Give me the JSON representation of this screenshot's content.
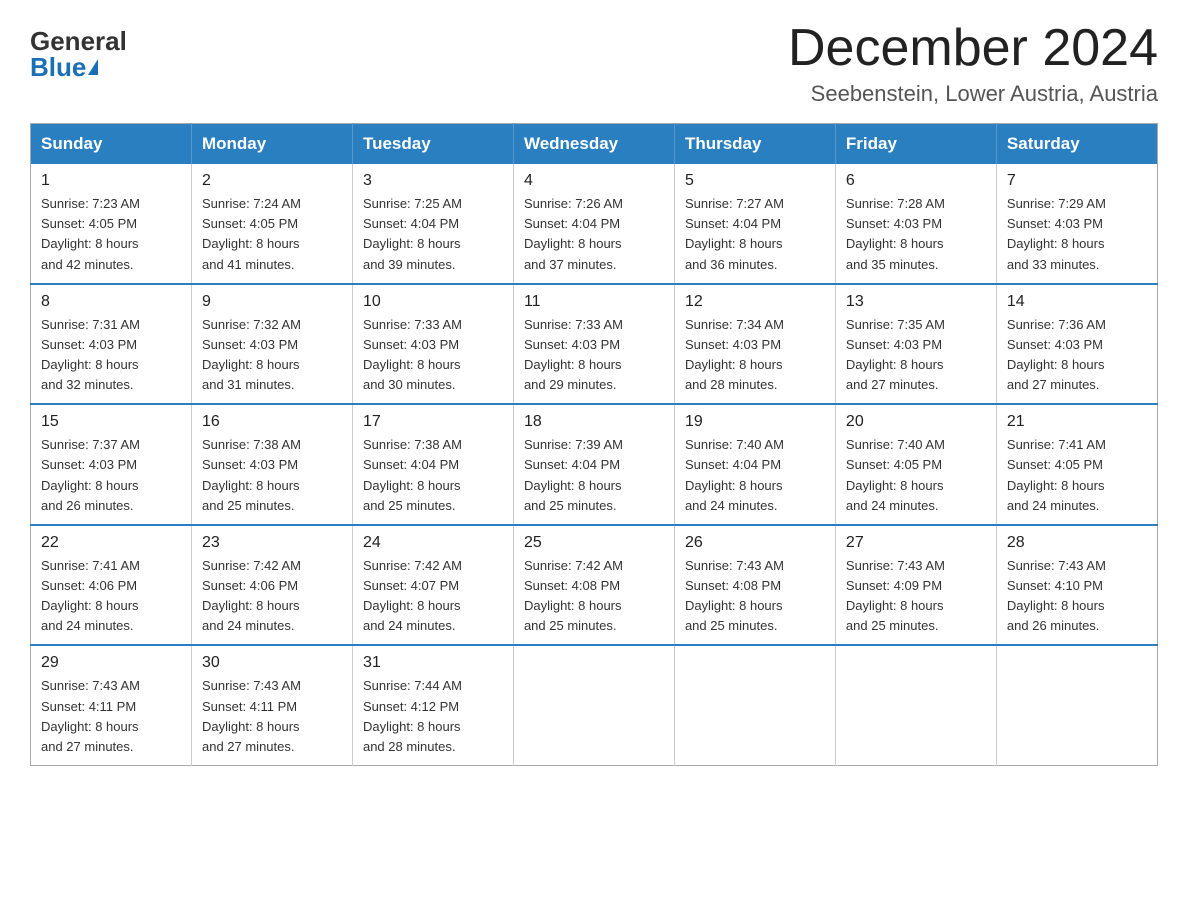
{
  "logo": {
    "general": "General",
    "blue": "Blue"
  },
  "title": "December 2024",
  "subtitle": "Seebenstein, Lower Austria, Austria",
  "weekdays": [
    "Sunday",
    "Monday",
    "Tuesday",
    "Wednesday",
    "Thursday",
    "Friday",
    "Saturday"
  ],
  "weeks": [
    [
      {
        "day": "1",
        "sunrise": "7:23 AM",
        "sunset": "4:05 PM",
        "daylight": "8 hours and 42 minutes."
      },
      {
        "day": "2",
        "sunrise": "7:24 AM",
        "sunset": "4:05 PM",
        "daylight": "8 hours and 41 minutes."
      },
      {
        "day": "3",
        "sunrise": "7:25 AM",
        "sunset": "4:04 PM",
        "daylight": "8 hours and 39 minutes."
      },
      {
        "day": "4",
        "sunrise": "7:26 AM",
        "sunset": "4:04 PM",
        "daylight": "8 hours and 37 minutes."
      },
      {
        "day": "5",
        "sunrise": "7:27 AM",
        "sunset": "4:04 PM",
        "daylight": "8 hours and 36 minutes."
      },
      {
        "day": "6",
        "sunrise": "7:28 AM",
        "sunset": "4:03 PM",
        "daylight": "8 hours and 35 minutes."
      },
      {
        "day": "7",
        "sunrise": "7:29 AM",
        "sunset": "4:03 PM",
        "daylight": "8 hours and 33 minutes."
      }
    ],
    [
      {
        "day": "8",
        "sunrise": "7:31 AM",
        "sunset": "4:03 PM",
        "daylight": "8 hours and 32 minutes."
      },
      {
        "day": "9",
        "sunrise": "7:32 AM",
        "sunset": "4:03 PM",
        "daylight": "8 hours and 31 minutes."
      },
      {
        "day": "10",
        "sunrise": "7:33 AM",
        "sunset": "4:03 PM",
        "daylight": "8 hours and 30 minutes."
      },
      {
        "day": "11",
        "sunrise": "7:33 AM",
        "sunset": "4:03 PM",
        "daylight": "8 hours and 29 minutes."
      },
      {
        "day": "12",
        "sunrise": "7:34 AM",
        "sunset": "4:03 PM",
        "daylight": "8 hours and 28 minutes."
      },
      {
        "day": "13",
        "sunrise": "7:35 AM",
        "sunset": "4:03 PM",
        "daylight": "8 hours and 27 minutes."
      },
      {
        "day": "14",
        "sunrise": "7:36 AM",
        "sunset": "4:03 PM",
        "daylight": "8 hours and 27 minutes."
      }
    ],
    [
      {
        "day": "15",
        "sunrise": "7:37 AM",
        "sunset": "4:03 PM",
        "daylight": "8 hours and 26 minutes."
      },
      {
        "day": "16",
        "sunrise": "7:38 AM",
        "sunset": "4:03 PM",
        "daylight": "8 hours and 25 minutes."
      },
      {
        "day": "17",
        "sunrise": "7:38 AM",
        "sunset": "4:04 PM",
        "daylight": "8 hours and 25 minutes."
      },
      {
        "day": "18",
        "sunrise": "7:39 AM",
        "sunset": "4:04 PM",
        "daylight": "8 hours and 25 minutes."
      },
      {
        "day": "19",
        "sunrise": "7:40 AM",
        "sunset": "4:04 PM",
        "daylight": "8 hours and 24 minutes."
      },
      {
        "day": "20",
        "sunrise": "7:40 AM",
        "sunset": "4:05 PM",
        "daylight": "8 hours and 24 minutes."
      },
      {
        "day": "21",
        "sunrise": "7:41 AM",
        "sunset": "4:05 PM",
        "daylight": "8 hours and 24 minutes."
      }
    ],
    [
      {
        "day": "22",
        "sunrise": "7:41 AM",
        "sunset": "4:06 PM",
        "daylight": "8 hours and 24 minutes."
      },
      {
        "day": "23",
        "sunrise": "7:42 AM",
        "sunset": "4:06 PM",
        "daylight": "8 hours and 24 minutes."
      },
      {
        "day": "24",
        "sunrise": "7:42 AM",
        "sunset": "4:07 PM",
        "daylight": "8 hours and 24 minutes."
      },
      {
        "day": "25",
        "sunrise": "7:42 AM",
        "sunset": "4:08 PM",
        "daylight": "8 hours and 25 minutes."
      },
      {
        "day": "26",
        "sunrise": "7:43 AM",
        "sunset": "4:08 PM",
        "daylight": "8 hours and 25 minutes."
      },
      {
        "day": "27",
        "sunrise": "7:43 AM",
        "sunset": "4:09 PM",
        "daylight": "8 hours and 25 minutes."
      },
      {
        "day": "28",
        "sunrise": "7:43 AM",
        "sunset": "4:10 PM",
        "daylight": "8 hours and 26 minutes."
      }
    ],
    [
      {
        "day": "29",
        "sunrise": "7:43 AM",
        "sunset": "4:11 PM",
        "daylight": "8 hours and 27 minutes."
      },
      {
        "day": "30",
        "sunrise": "7:43 AM",
        "sunset": "4:11 PM",
        "daylight": "8 hours and 27 minutes."
      },
      {
        "day": "31",
        "sunrise": "7:44 AM",
        "sunset": "4:12 PM",
        "daylight": "8 hours and 28 minutes."
      },
      null,
      null,
      null,
      null
    ]
  ],
  "labels": {
    "sunrise": "Sunrise:",
    "sunset": "Sunset:",
    "daylight": "Daylight:"
  }
}
